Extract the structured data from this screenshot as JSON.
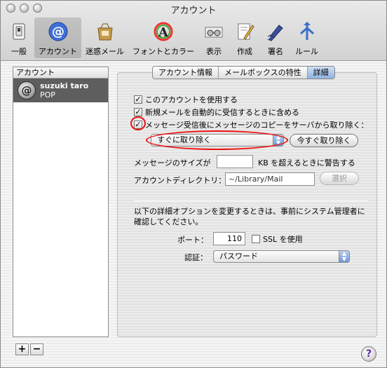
{
  "window": {
    "title": "アカウント"
  },
  "toolbar": {
    "items": [
      {
        "label": "一般",
        "icon": "switch-icon"
      },
      {
        "label": "アカウント",
        "icon": "at-sign-icon"
      },
      {
        "label": "迷惑メール",
        "icon": "junk-mail-bag-icon"
      },
      {
        "label": "フォントとカラー",
        "icon": "color-letter-a-icon"
      },
      {
        "label": "表示",
        "icon": "glasses-icon"
      },
      {
        "label": "作成",
        "icon": "pencil-paper-icon"
      },
      {
        "label": "署名",
        "icon": "fountain-pen-icon"
      },
      {
        "label": "ルール",
        "icon": "rules-arrows-icon"
      }
    ]
  },
  "sidebar": {
    "header": "アカウント",
    "accounts": [
      {
        "name": "suzuki taro",
        "type": "POP"
      }
    ],
    "add_label": "+",
    "remove_label": "−"
  },
  "tabs": [
    "アカウント情報",
    "メールボックスの特性",
    "詳細"
  ],
  "options": {
    "use_account": "このアカウントを使用する",
    "include_auto_check": "新規メールを自動的に受信するときに含める",
    "remove_copy": "メッセージ受信後にメッセージのコピーをサーバから取り除く："
  },
  "remove_timing": {
    "selected": "すぐに取り除く"
  },
  "remove_now_button": "今すぐ取り除く",
  "message_size": {
    "label": "メッセージのサイズが",
    "value": "",
    "suffix": "KB を超えるときに警告する"
  },
  "account_directory": {
    "label": "アカウントディレクトリ：",
    "value": "~/Library/Mail",
    "button": "選択"
  },
  "advanced_note": "以下の詳細オプションを変更するときは、事前にシステム管理者に確認してください。",
  "port": {
    "label": "ポート：",
    "value": "110",
    "ssl_label": "SSL を使用"
  },
  "auth": {
    "label": "認証：",
    "selected": "パスワード"
  },
  "help": "?"
}
